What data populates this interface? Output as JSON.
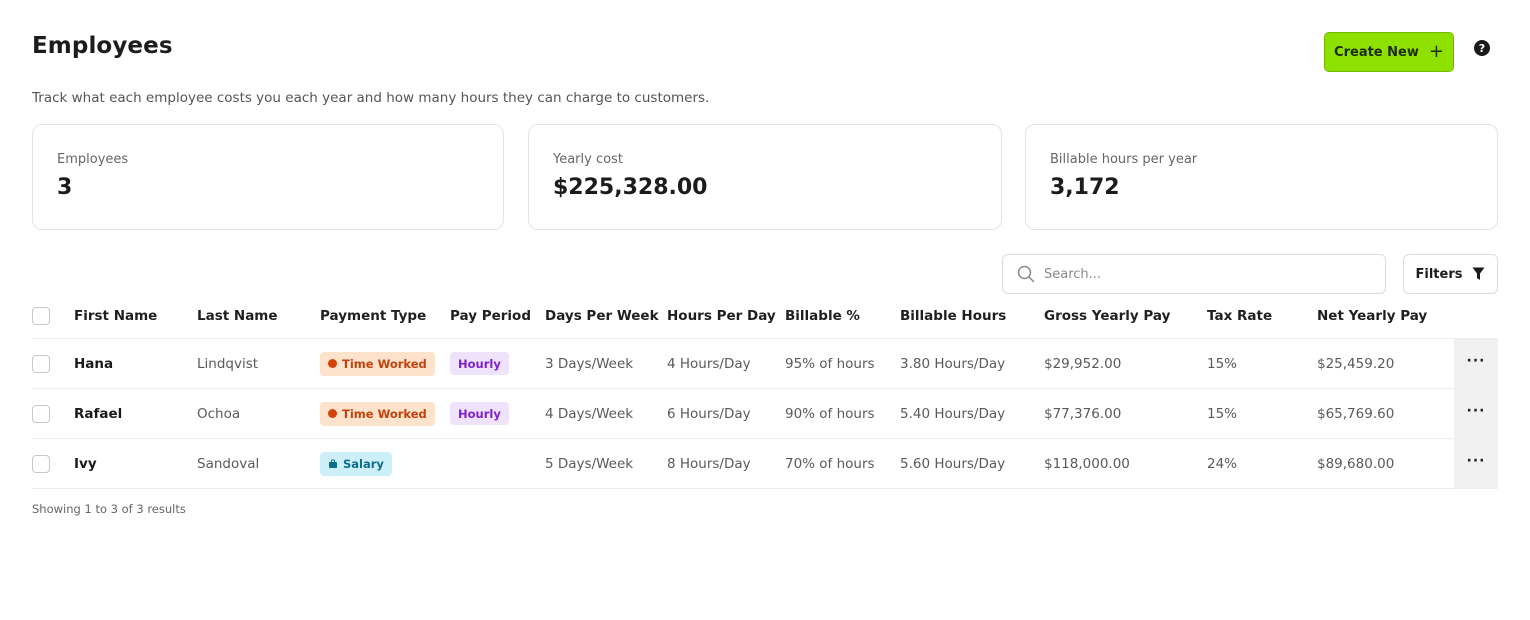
{
  "page": {
    "title": "Employees",
    "subtitle": "Track what each employee costs you each year and how many hours they can charge to customers.",
    "create_button": "Create New",
    "create_icon": "+",
    "help_icon": "?"
  },
  "stats": [
    {
      "label": "Employees",
      "value": "3"
    },
    {
      "label": "Yearly cost",
      "value": "$225,328.00"
    },
    {
      "label": "Billable hours per year",
      "value": "3,172"
    }
  ],
  "toolbar": {
    "search_placeholder": "Search...",
    "filters_label": "Filters"
  },
  "table": {
    "columns": [
      "First Name",
      "Last Name",
      "Payment Type",
      "Pay Period",
      "Days Per Week",
      "Hours Per Day",
      "Billable %",
      "Billable Hours",
      "Gross Yearly Pay",
      "Tax Rate",
      "Net Yearly Pay"
    ],
    "rows": [
      {
        "first": "Hana",
        "last": "Lindqvist",
        "payment_type": "Time Worked",
        "pay_period": "Hourly",
        "days": "3 Days/Week",
        "hours": "4 Hours/Day",
        "billable_pct": "95% of hours",
        "billable_hours": "3.80 Hours/Day",
        "gross": "$29,952.00",
        "tax": "15%",
        "net": "$25,459.20"
      },
      {
        "first": "Rafael",
        "last": "Ochoa",
        "payment_type": "Time Worked",
        "pay_period": "Hourly",
        "days": "4 Days/Week",
        "hours": "6 Hours/Day",
        "billable_pct": "90% of hours",
        "billable_hours": "5.40 Hours/Day",
        "gross": "$77,376.00",
        "tax": "15%",
        "net": "$65,769.60"
      },
      {
        "first": "Ivy",
        "last": "Sandoval",
        "payment_type": "Salary",
        "pay_period": "",
        "days": "5 Days/Week",
        "hours": "8 Hours/Day",
        "billable_pct": "70% of hours",
        "billable_hours": "5.60 Hours/Day",
        "gross": "$118,000.00",
        "tax": "24%",
        "net": "$89,680.00"
      }
    ],
    "row_menu_icon": "···"
  },
  "footer": {
    "summary": "Showing 1 to 3 of 3 results"
  },
  "colors": {
    "accent": "#8ee000",
    "time_badge_bg": "#fde3cc",
    "time_badge_fg": "#c2410c",
    "salary_badge_bg": "#cdeffa",
    "salary_badge_fg": "#0e6f8a",
    "hourly_badge_bg": "#efe2fb",
    "hourly_badge_fg": "#7e22ce"
  }
}
